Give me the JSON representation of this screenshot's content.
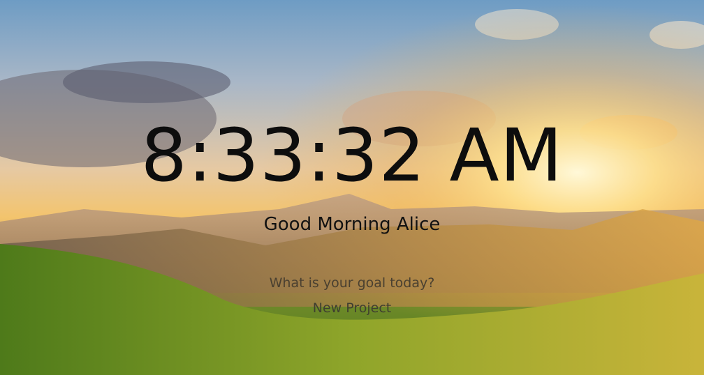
{
  "clock": {
    "time": "8:33:32 AM"
  },
  "greeting": {
    "text": "Good Morning Alice"
  },
  "goal": {
    "question": "What is your goal today?",
    "value": "New Project"
  },
  "colors": {
    "text_primary": "#0d0d0d",
    "text_secondary": "#4a4030",
    "sky": "#6e9cc4",
    "sun": "#fff4c2",
    "grass": "#6f8a2a"
  }
}
